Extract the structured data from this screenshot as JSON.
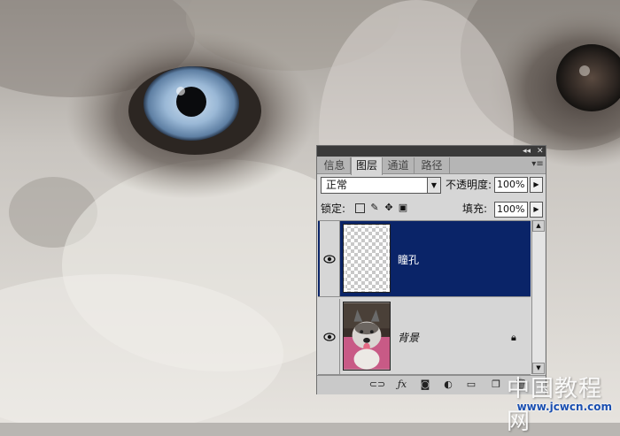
{
  "panel": {
    "tabs": [
      "信息",
      "图层",
      "通道",
      "路径"
    ],
    "active_tab": 1,
    "blend_mode": "正常",
    "opacity_label": "不透明度:",
    "opacity_value": "100%",
    "lock_label": "锁定:",
    "fill_label": "填充:",
    "fill_value": "100%",
    "layers": [
      {
        "name": "瞳孔",
        "selected": true,
        "visible": true,
        "thumbnail": "transparent"
      },
      {
        "name": "背景",
        "selected": false,
        "visible": true,
        "thumbnail": "husky-photo",
        "locked": true
      }
    ],
    "bottom_icons": [
      "link-icon",
      "fx-icon",
      "mask-icon",
      "adjustment-icon",
      "group-folder-icon",
      "new-layer-icon",
      "trash-icon"
    ]
  },
  "watermark": {
    "text_cn": "中国教程网",
    "url": "www.jcwcn.com"
  },
  "colors": {
    "selection": "#0a2468",
    "panel_bg": "#d6d6d6",
    "eye_iris": "#8fb0cf"
  }
}
